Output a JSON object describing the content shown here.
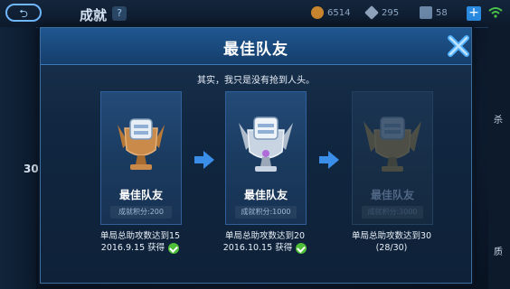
{
  "topbar": {
    "title": "成就",
    "help_label": "?",
    "resources": [
      {
        "icon": "gold-coin-icon",
        "value": "6514",
        "color": "#c9862e"
      },
      {
        "icon": "diamond-icon",
        "value": "295",
        "color": "#8fa3bd"
      },
      {
        "icon": "voucher-icon",
        "value": "58",
        "color": "#6a87a8"
      }
    ],
    "plus_label": "+"
  },
  "background": {
    "left_number": "30",
    "right_text_1": "杀",
    "right_text_2": "质"
  },
  "modal": {
    "title": "最佳队友",
    "subtitle": "其实，我只是没有抢到人头。",
    "close_icon": "close-x-icon",
    "accent_color": "#1f5791"
  },
  "achievements": [
    {
      "name": "最佳队友",
      "tier": "bronze",
      "score": "成就积分:200",
      "description_line1": "单局总助攻数达到15",
      "date": "2016.9.15",
      "status": "获得",
      "completed": true
    },
    {
      "name": "最佳队友",
      "tier": "silver",
      "score": "成就积分:1000",
      "description_line1": "单局总助攻数达到20",
      "date": "2016.10.15",
      "status": "获得",
      "completed": true
    },
    {
      "name": "最佳队友",
      "tier": "gold",
      "score": "成就积分:3000",
      "description_line1": "单局总助攻数达到30",
      "progress": "(28/30)",
      "completed": false
    }
  ]
}
